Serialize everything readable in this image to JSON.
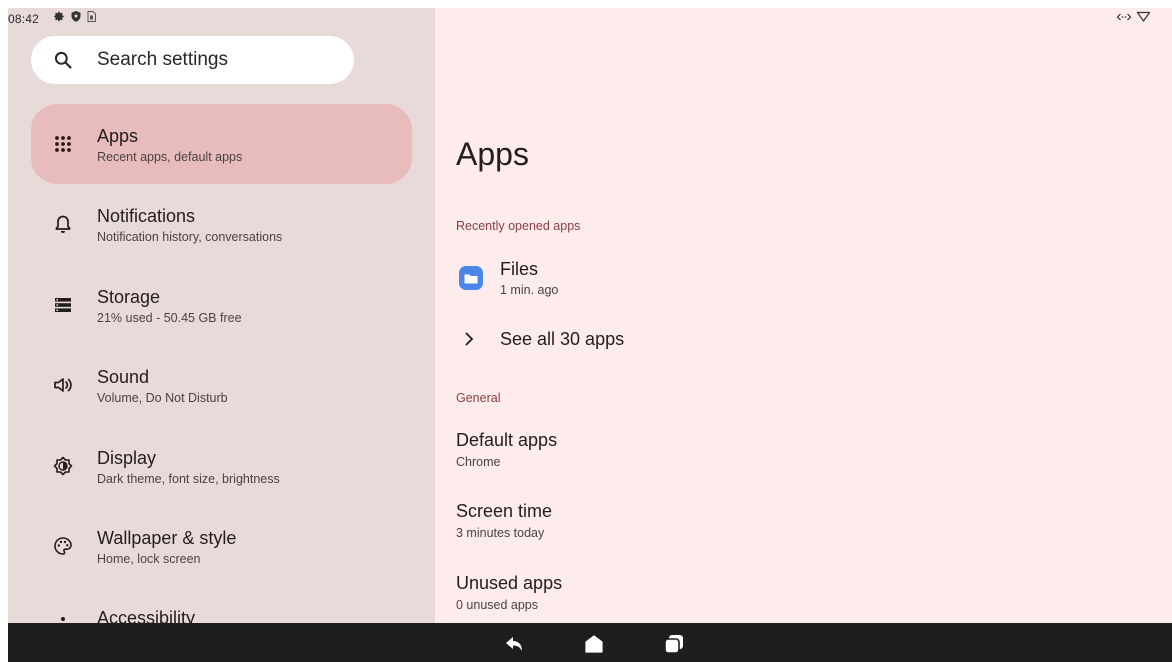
{
  "status_bar": {
    "time": "08:42"
  },
  "search": {
    "placeholder": "Search settings"
  },
  "sidebar": {
    "items": [
      {
        "title": "Apps",
        "subtitle": "Recent apps, default apps",
        "icon": "apps-grid-icon",
        "selected": true
      },
      {
        "title": "Notifications",
        "subtitle": "Notification history, conversations",
        "icon": "bell-icon"
      },
      {
        "title": "Storage",
        "subtitle": "21% used - 50.45 GB free",
        "icon": "storage-icon"
      },
      {
        "title": "Sound",
        "subtitle": "Volume, Do Not Disturb",
        "icon": "speaker-icon"
      },
      {
        "title": "Display",
        "subtitle": "Dark theme, font size, brightness",
        "icon": "brightness-icon"
      },
      {
        "title": "Wallpaper & style",
        "subtitle": "Home, lock screen",
        "icon": "palette-icon"
      },
      {
        "title": "Accessibility",
        "subtitle": "",
        "icon": "accessibility-icon"
      }
    ]
  },
  "main": {
    "title": "Apps",
    "recent_section": "Recently opened apps",
    "recent_app": {
      "name": "Files",
      "time": "1 min. ago",
      "icon": "files-folder-icon"
    },
    "see_all": "See all 30 apps",
    "general_section": "General",
    "general_items": [
      {
        "title": "Default apps",
        "subtitle": "Chrome"
      },
      {
        "title": "Screen time",
        "subtitle": "3 minutes today"
      },
      {
        "title": "Unused apps",
        "subtitle": "0 unused apps"
      }
    ]
  },
  "colors": {
    "sidebar_bg": "#e8dad9",
    "content_bg": "#fdeceb",
    "selected_bg": "#e8bcbc",
    "section_header": "#8b3f3f",
    "files_blue": "#4a86e8"
  }
}
